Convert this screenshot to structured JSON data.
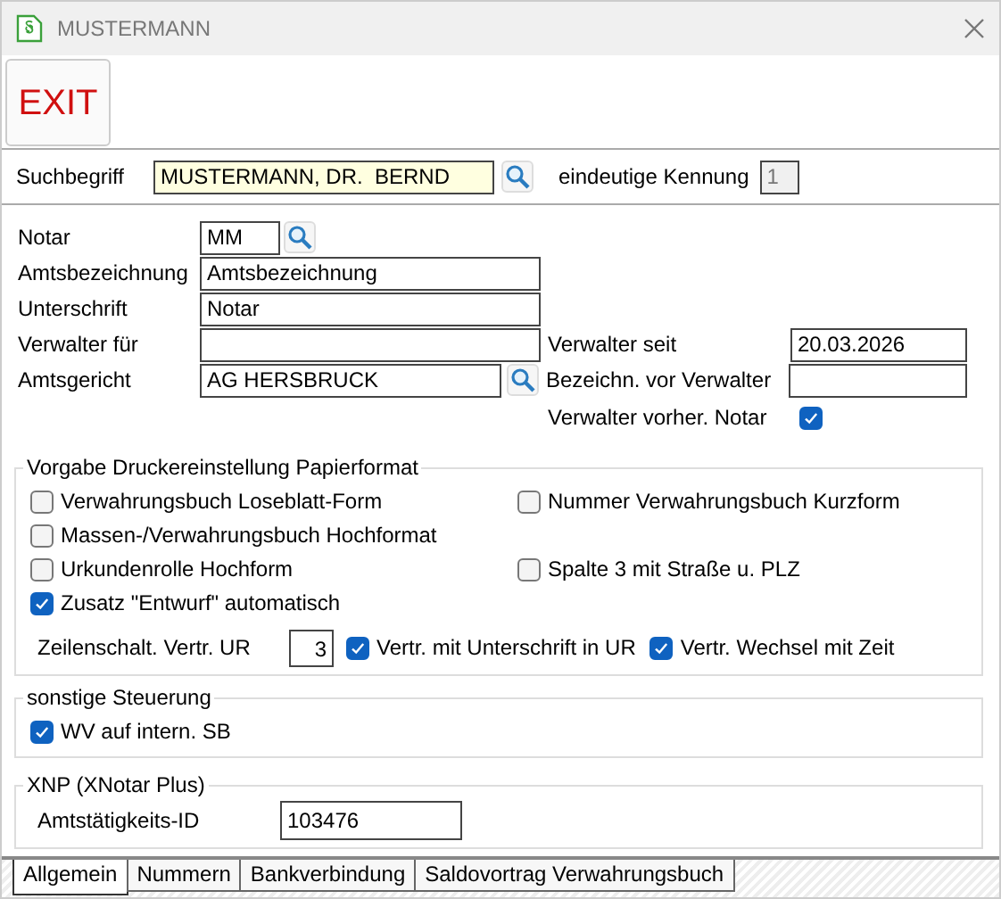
{
  "window": {
    "title": "MUSTERMANN"
  },
  "toolbar": {
    "exit_button": "EXIT"
  },
  "search": {
    "label": "Suchbegriff",
    "value": "MUSTERMANN, DR.  BERND",
    "id_label": "eindeutige Kennung",
    "id_value": "1"
  },
  "form": {
    "notar": {
      "label": "Notar",
      "value": "MM"
    },
    "amtsbezeichnung": {
      "label": "Amtsbezeichnung",
      "value": "Amtsbezeichnung"
    },
    "unterschrift": {
      "label": "Unterschrift",
      "value": "Notar"
    },
    "verwalter_fuer": {
      "label": "Verwalter für"
    },
    "verwalter_seit": {
      "label": "Verwalter seit",
      "value": "20.03.2026"
    },
    "amtsgericht": {
      "label": "Amtsgericht",
      "value": "AG HERSBRUCK"
    },
    "bezeichn_vor_verwalter": {
      "label": "Bezeichn. vor Verwalter"
    },
    "verwalter_vorher_notar": {
      "label": "Verwalter vorher. Notar",
      "checked": true
    }
  },
  "print_settings": {
    "legend": "Vorgabe Druckereinstellung Papierformat",
    "rows": [
      [
        {
          "label": "Verwahrungsbuch Loseblatt-Form",
          "checked": false
        },
        {
          "label": "Nummer Verwahrungsbuch Kurzform",
          "checked": false
        }
      ],
      [
        {
          "label": "Massen-/Verwahrungsbuch Hochformat",
          "checked": false
        }
      ],
      [
        {
          "label": "Urkundenrolle Hochform",
          "checked": false
        },
        {
          "label": "Spalte 3 mit Straße u. PLZ",
          "checked": false
        }
      ],
      [
        {
          "label": "Zusatz \"Entwurf\" automatisch",
          "checked": true
        }
      ]
    ],
    "line_spacing": {
      "label": "Zeilenschalt. Vertr. UR",
      "value": "3"
    },
    "line_options": [
      {
        "label": "Vertr. mit Unterschrift in UR",
        "checked": true
      },
      {
        "label": "Vertr. Wechsel mit Zeit",
        "checked": true
      }
    ]
  },
  "other_control": {
    "legend": "sonstige Steuerung",
    "options": [
      {
        "label": "WV auf intern. SB",
        "checked": true
      }
    ]
  },
  "xnp": {
    "legend": "XNP (XNotar Plus)",
    "id_label": "Amtstätigkeits-ID",
    "id_value": "103476"
  },
  "tabs": [
    {
      "label": "Allgemein",
      "selected": true
    },
    {
      "label": "Nummern",
      "selected": false
    },
    {
      "label": "Bankverbindung",
      "selected": false
    },
    {
      "label": "Saldovortrag Verwahrungsbuch",
      "selected": false
    }
  ]
}
